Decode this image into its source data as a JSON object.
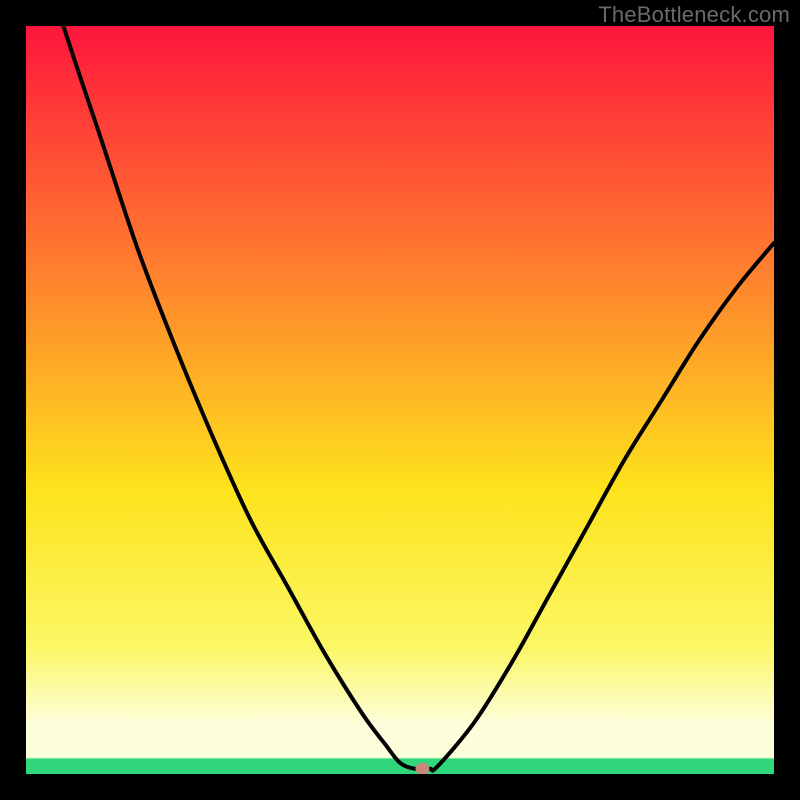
{
  "watermark": "TheBottleneck.com",
  "chart_data": {
    "type": "line",
    "title": "",
    "xlabel": "",
    "ylabel": "",
    "xlim": [
      0,
      100
    ],
    "ylim": [
      0,
      100
    ],
    "x": [
      0,
      5,
      10,
      15,
      20,
      25,
      30,
      35,
      40,
      45,
      48,
      50,
      52,
      54,
      55,
      60,
      65,
      70,
      75,
      80,
      85,
      90,
      95,
      100
    ],
    "values": [
      116,
      100,
      85,
      70,
      57,
      45,
      34,
      25,
      16,
      8,
      4,
      1.5,
      0.7,
      0.7,
      1,
      7,
      15,
      24,
      33,
      42,
      50,
      58,
      65,
      71
    ],
    "marker": {
      "x": 53,
      "y": 0.7,
      "color": "#c98779"
    },
    "bottom_band_top": 6.5,
    "green_band_top": 2.0
  },
  "gradient": {
    "top": "#fe163c",
    "upper_mid": "#ff7d2e",
    "mid": "#fde31c",
    "lower_mid": "#fbf765",
    "pale": "#fdfedc",
    "green": "#2fd67a"
  }
}
